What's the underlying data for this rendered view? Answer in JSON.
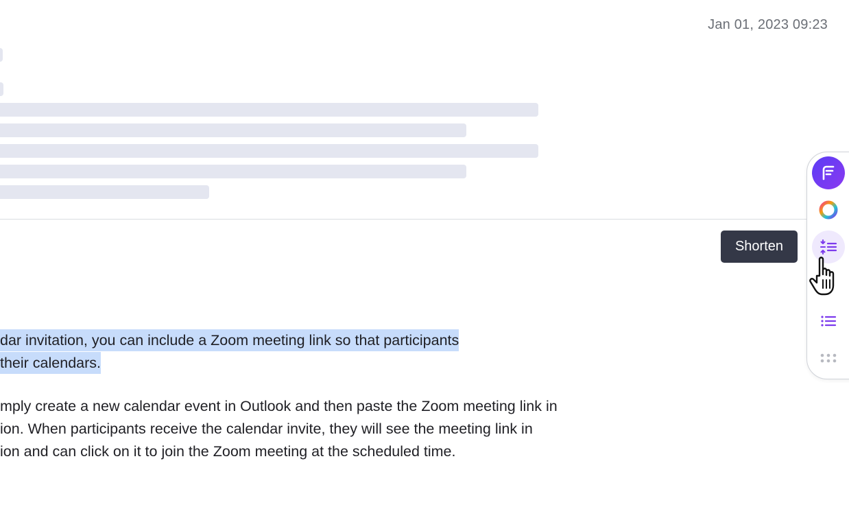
{
  "header": {
    "timestamp": "Jan 01, 2023 09:23"
  },
  "skeleton_lines": 7,
  "content": {
    "paragraph1": [
      "dar invitation, you can include a Zoom meeting link so that participants",
      "their calendars."
    ],
    "paragraph2": [
      "mply create a new calendar event in Outlook and then paste the Zoom meeting link in",
      "ion. When participants receive the calendar invite, they will see the meeting link in",
      "ion and can click on it to join the Zoom meeting at the scheduled time."
    ]
  },
  "toolbar": {
    "items": [
      {
        "icon": "app-logo-icon"
      },
      {
        "icon": "color-ring-icon"
      },
      {
        "icon": "shorten-icon"
      },
      {
        "icon": "list-icon"
      },
      {
        "icon": "grip-dots-icon"
      }
    ],
    "tooltip": "Shorten"
  },
  "colors": {
    "accent": "#7c3aed",
    "highlight": "#c7dcfb",
    "tooltip_bg": "#343847",
    "skeleton": "#e4e6f0"
  }
}
